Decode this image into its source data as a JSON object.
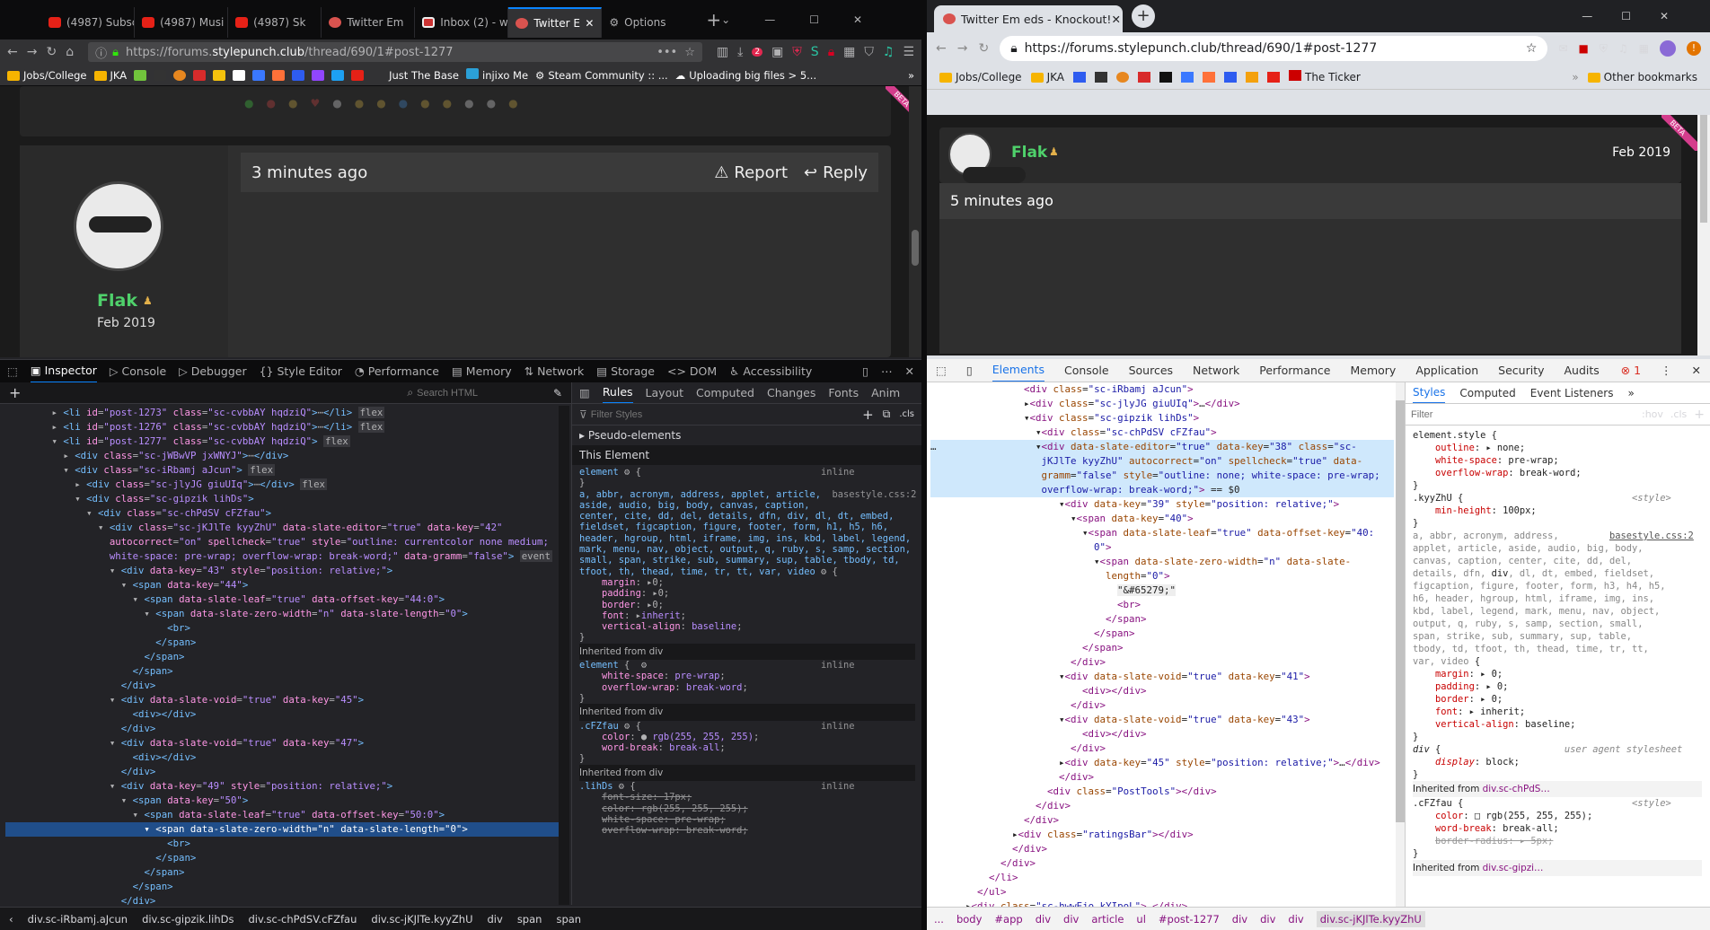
{
  "firefox": {
    "tabs": [
      {
        "label": "(4987) Subsc",
        "fav": "yt"
      },
      {
        "label": "(4987) Musi",
        "fav": "yt"
      },
      {
        "label": "(4987) Sk",
        "fav": "yt"
      },
      {
        "label": "Twitter Em",
        "fav": "ko"
      },
      {
        "label": "Inbox (2) - w",
        "fav": "gm"
      },
      {
        "label": "Twitter E",
        "fav": "ko",
        "active": true
      },
      {
        "label": "Options",
        "fav": "gear"
      }
    ],
    "url_prefix": "https://forums.",
    "url_domain": "stylepunch.club",
    "url_suffix": "/thread/690/1#post-1277",
    "badge_count": "2",
    "bookmarks": [
      "Jobs/College",
      "JKA",
      "Just The Base",
      "injixo Me",
      "Steam Community :: ...",
      "Uploading big files > 5..."
    ],
    "post": {
      "time": "3 minutes ago",
      "report": "Report",
      "reply": "Reply",
      "username": "Flak",
      "joined": "Feb 2019",
      "beta": "BETA"
    },
    "devtools": {
      "tabs": [
        "Inspector",
        "Console",
        "Debugger",
        "Style Editor",
        "Performance",
        "Memory",
        "Network",
        "Storage",
        "DOM",
        "Accessibility"
      ],
      "search_placeholder": "Search HTML",
      "side_tabs": [
        "Rules",
        "Layout",
        "Computed",
        "Changes",
        "Fonts",
        "Anim"
      ],
      "filter_placeholder": "Filter Styles",
      "pseudo": "Pseudo-elements",
      "this_element": "This Element",
      "breadcrumbs": [
        "div.sc-iRbamj.aJcun",
        "div.sc-gipzik.lihDs",
        "div.sc-chPdSV.cFZfau",
        "div.sc-jKJlTe.kyyZhU",
        "div",
        "span",
        "span"
      ]
    }
  },
  "chrome": {
    "tab_label": "Twitter Em  eds - Knockout!",
    "url": "https://forums.stylepunch.club/thread/690/1#post-1277",
    "bookmarks": [
      "Jobs/College",
      "JKA",
      "The Ticker",
      "Other bookmarks"
    ],
    "post": {
      "username": "Flak",
      "date": "Feb 2019",
      "time": "5 minutes ago",
      "beta": "BETA"
    },
    "devtools": {
      "tabs": [
        "Elements",
        "Console",
        "Sources",
        "Network",
        "Performance",
        "Memory",
        "Application",
        "Security",
        "Audits"
      ],
      "error_count": "1",
      "side_tabs": [
        "Styles",
        "Computed",
        "Event Listeners"
      ],
      "filter_placeholder": "Filter",
      "hov": ":hov",
      "cls": ".cls",
      "breadcrumbs": [
        "...",
        "body",
        "#app",
        "div",
        "div",
        "article",
        "ul",
        "#post-1277",
        "div",
        "div",
        "div",
        "div.sc-jKJlTe.kyyZhU"
      ]
    }
  }
}
